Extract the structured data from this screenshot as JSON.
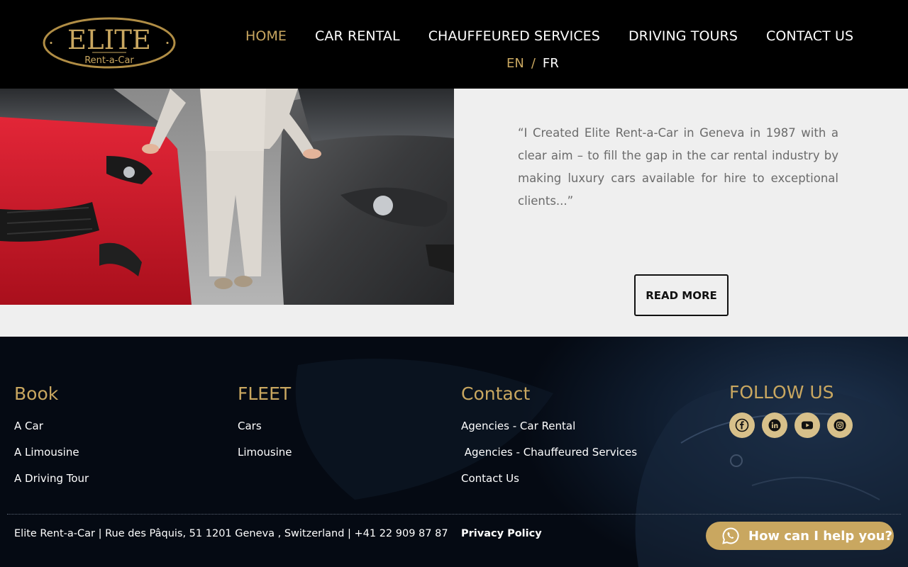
{
  "brand": {
    "name": "ELITE",
    "tagline": "Rent-a-Car",
    "gold": "#c9a760"
  },
  "nav": {
    "items": [
      {
        "label": "HOME",
        "active": true
      },
      {
        "label": "CAR RENTAL",
        "active": false
      },
      {
        "label": "CHAUFFEURED SERVICES",
        "active": false
      },
      {
        "label": "DRIVING TOURS",
        "active": false
      },
      {
        "label": "CONTACT US",
        "active": false
      }
    ],
    "lang_en": "EN",
    "lang_sep": "/",
    "lang_fr": "FR"
  },
  "hero": {
    "quote": "“I Created Elite Rent-a-Car in Geneva in 1987 with a clear aim – to fill the gap in the car rental industry by making luxury cars available for hire to exceptional clients...”",
    "read_more": "READ MORE"
  },
  "footer": {
    "book": {
      "title": "Book",
      "links": [
        "A Car",
        "A Limousine",
        "A Driving Tour"
      ]
    },
    "fleet": {
      "title": "FLEET",
      "links": [
        "Cars",
        "Limousine"
      ]
    },
    "contact": {
      "title": "Contact",
      "links": [
        "Agencies - Car Rental",
        " Agencies - Chauffeured Services",
        "Contact Us"
      ]
    },
    "follow": {
      "title": "FOLLOW US",
      "icons": [
        "facebook-icon",
        "linkedin-icon",
        "youtube-icon",
        "instagram-icon"
      ]
    },
    "address": "Elite Rent-a-Car | Rue des Pâquis, 51 1201 Geneva , Switzerland | +41 22 909 87 87",
    "privacy": "Privacy Policy"
  },
  "chat": {
    "label": "How can I help you?",
    "icon": "whatsapp-icon"
  }
}
